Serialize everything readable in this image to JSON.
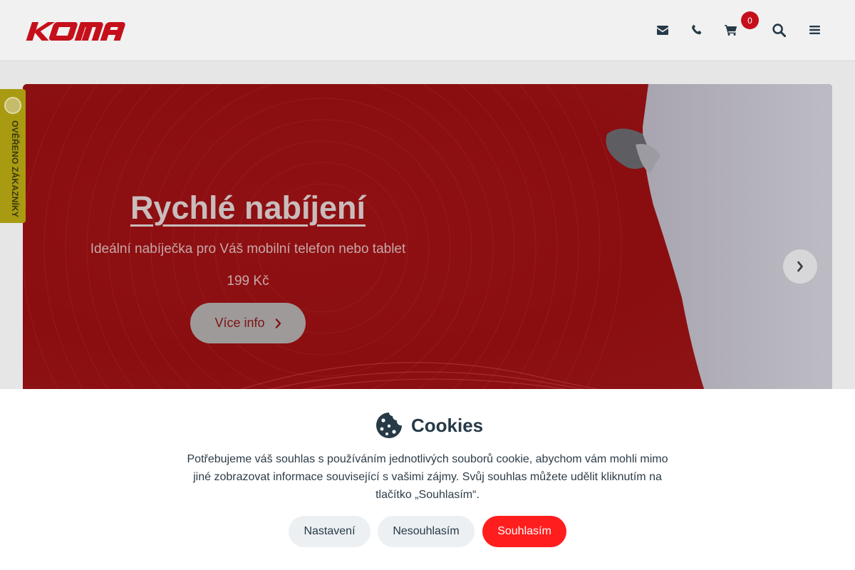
{
  "header": {
    "logo_text": "KOMA",
    "cart_count": "0",
    "icons": [
      "envelope-icon",
      "phone-icon",
      "cart-icon",
      "search-icon",
      "menu-icon"
    ],
    "brand_color": "#c5101b"
  },
  "verified_badge": {
    "label": "OVĚŘENO ZÁKAZNÍKY",
    "color": "#a89b12"
  },
  "hero": {
    "title": "Rychlé nabíjení",
    "subtitle": "Ideální nabíječka pro Váš mobilní telefon nebo tablet",
    "price": "199 Kč",
    "button_label": "Více info",
    "next_icon": "chevron-right-icon"
  },
  "cookies": {
    "title": "Cookies",
    "text": "Potřebujeme váš souhlas s používáním jednotlivých souborů cookie, abychom vám mohli mimo jiné zobrazovat informace související s vašimi zájmy. Svůj souhlas můžete udělit kliknutím na tlačítko „Souhlasím“.",
    "buttons": {
      "settings": "Nastavení",
      "decline": "Nesouhlasím",
      "accept": "Souhlasím"
    },
    "accept_color": "#ff1e1e"
  }
}
